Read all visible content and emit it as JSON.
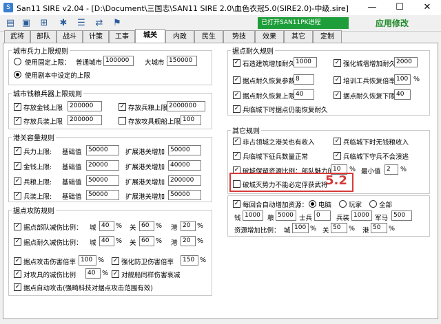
{
  "window": {
    "title": "San11 SIRE v2.04 - [D:\\Document\\三国志\\SAN11 SIRE 2.0\\血色衣冠5.0(SIRE2.0)-中级.sire]",
    "minimize": "—",
    "maximize": "☐",
    "close": "✕"
  },
  "toolbar": {
    "status": "已打开SAN11PK进程",
    "edit_label": "应用修改"
  },
  "tabs": [
    "武将",
    "部队",
    "战斗",
    "计策",
    "工事",
    "城关",
    "内政",
    "民生",
    "势技",
    "效果",
    "其它",
    "定制"
  ],
  "active_tab": "城关",
  "city_troops": {
    "title": "城市兵力上限规则",
    "opt_fixed": "使用固定上限：",
    "normal_label": "普通城市",
    "normal_value": "100000",
    "big_label": "大城市",
    "big_value": "150000",
    "opt_script": "使用剧本中设定的上限"
  },
  "city_store": {
    "title": "城市钱粮兵器上限规则",
    "gold_label": "存放金钱上限",
    "gold_value": "200000",
    "food_label": "存放兵粮上限",
    "food_value": "2000000",
    "arms_label": "存放兵装上限",
    "arms_value": "200000",
    "ship_label": "存放攻具舰船上限",
    "ship_value": "100"
  },
  "port_cap": {
    "title": "港关容量规则",
    "rows": [
      {
        "label": "兵力上限:",
        "base_label": "基础值",
        "base": "50000",
        "inc_label": "扩展港关增加",
        "inc": "50000"
      },
      {
        "label": "金钱上限:",
        "base_label": "基础值",
        "base": "20000",
        "inc_label": "扩展港关增加",
        "inc": "40000"
      },
      {
        "label": "兵粮上限:",
        "base_label": "基础值",
        "base": "50000",
        "inc_label": "扩展港关增加",
        "inc": "200000"
      },
      {
        "label": "兵装上限:",
        "base_label": "基础值",
        "base": "50000",
        "inc_label": "扩展港关增加",
        "inc": "50000"
      }
    ]
  },
  "attack_defense": {
    "title": "据点攻防规则",
    "unit_label": "据点部队减伤比例：",
    "dur_label": "据点耐久减伤比例：",
    "city_label": "城",
    "gate_label": "关",
    "port_label": "港",
    "unit_city": "40",
    "unit_gate": "60",
    "unit_port": "20",
    "dur_city": "40",
    "dur_gate": "60",
    "dur_port": "20",
    "atk_mult_label": "据点攻击伤害倍率",
    "atk_mult": "100",
    "def_mult_label": "强化防卫伤害倍率",
    "def_mult": "150",
    "siege_label": "对攻具的减伤比例",
    "siege_value": "40",
    "ship_label": "对舰船同样伤害衰减",
    "auto_label": "据点自动攻击(强畸科技对据点攻击范围有效)",
    "percent": "%"
  },
  "durability": {
    "title": "据点耐久规则",
    "stone_label": "石造建筑增加耐久",
    "stone_value": "1000",
    "wall_label": "强化城墙增加耐久",
    "wall_value": "2000",
    "recover_label": "据点耐久恢复参数",
    "recover_value": "8",
    "worker_label": "培训工兵恢复倍率",
    "worker_value": "100",
    "max_label": "据点耐久恢复上限",
    "max_value": "40",
    "min_label": "据点耐久恢复下限",
    "min_value": "40",
    "troops_label": "兵临城下时据点仍能恢复耐久",
    "percent": "%"
  },
  "other": {
    "title": "其它规则",
    "r1a": "非占领城之港关也有收入",
    "r1b": "兵临城下时无钱粮收入",
    "r2a": "兵临城下征兵数量正常",
    "r2b": "兵临城下守兵不会溃逃",
    "r3a": "破城保留资源比例：部队魅力的",
    "r3_value": "10",
    "r3_percent": "%",
    "r3_min_label": "最小值",
    "r3_min": "2",
    "r4": "破城灭势力不能必定俘获武将",
    "callout": "5.2"
  },
  "auto_resource": {
    "label": "每回合自动增加资源：",
    "opt_computer": "电脑",
    "opt_player": "玩家",
    "opt_all": "全部",
    "gold_label": "钱",
    "gold": "1000",
    "food_label": "粮",
    "food": "5000",
    "soldier_label": "士兵",
    "soldier": "0",
    "arms_label": "兵装",
    "arms": "1000",
    "horse_label": "军马",
    "horse": "500",
    "ratio_label": "资源增加比例：",
    "city_label": "城",
    "city": "100",
    "gate_label": "关",
    "gate": "50",
    "port_label": "港",
    "port": "50",
    "percent": "%"
  }
}
